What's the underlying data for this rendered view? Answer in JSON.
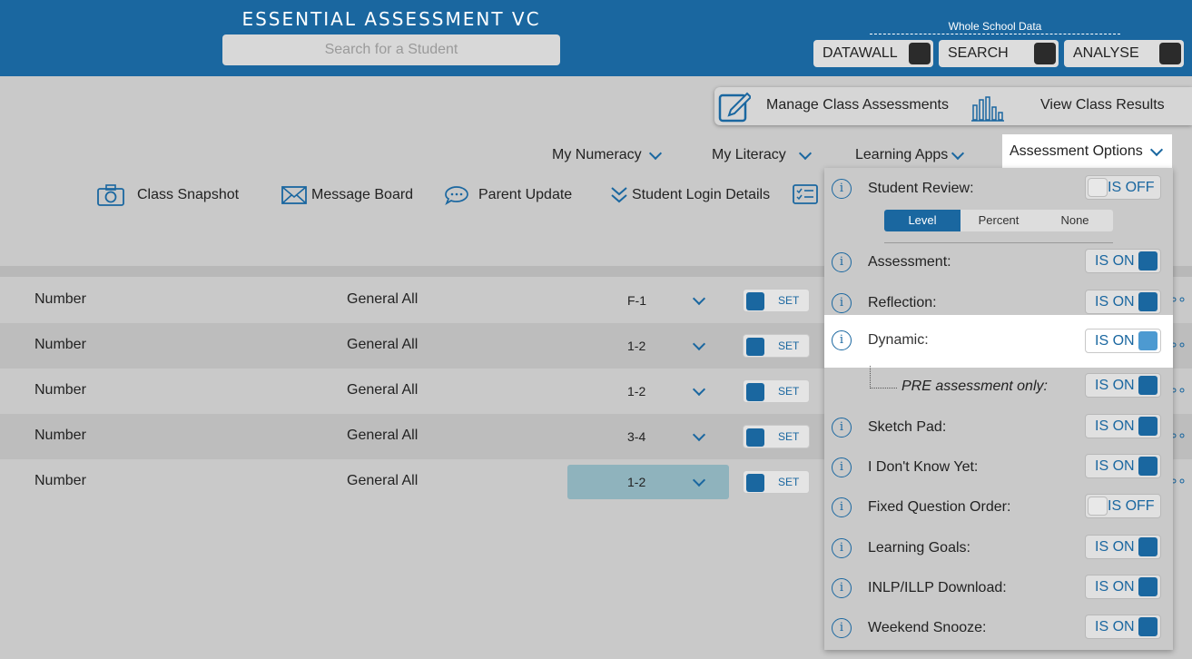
{
  "header": {
    "title": "ESSENTIAL ASSESSMENT VC",
    "search_placeholder": "Search for a Student",
    "whole_school_label": "Whole School Data",
    "buttons": [
      {
        "label": "DATAWALL"
      },
      {
        "label": "SEARCH"
      },
      {
        "label": "ANALYSE"
      }
    ]
  },
  "manage": {
    "manage_label": "Manage Class Assessments",
    "results_label": "View Class Results"
  },
  "nav": {
    "items": [
      {
        "label": "My Numeracy"
      },
      {
        "label": "My Literacy"
      },
      {
        "label": "Learning Apps"
      },
      {
        "label": "Assessment Options"
      }
    ]
  },
  "actions": {
    "items": [
      {
        "label": "Class Snapshot",
        "icon": "camera-icon"
      },
      {
        "label": "Message Board",
        "icon": "envelope-icon"
      },
      {
        "label": "Parent Update",
        "icon": "speech-bubble-icon"
      },
      {
        "label": "Student Login Details",
        "icon": "double-chevron-icon"
      }
    ]
  },
  "table": {
    "rows": [
      {
        "strand": "Number",
        "type": "General All",
        "year": "F-1",
        "set": "SET"
      },
      {
        "strand": "Number",
        "type": "General All",
        "year": "1-2",
        "set": "SET"
      },
      {
        "strand": "Number",
        "type": "General All",
        "year": "1-2",
        "set": "SET"
      },
      {
        "strand": "Number",
        "type": "General All",
        "year": "3-4",
        "set": "SET"
      },
      {
        "strand": "Number",
        "type": "General All",
        "year": "1-2",
        "set": "SET"
      }
    ]
  },
  "options": {
    "student_review": {
      "label": "Student Review:",
      "state": "IS OFF"
    },
    "segments": [
      "Level",
      "Percent",
      "None"
    ],
    "selected_segment": "Level",
    "items": [
      {
        "label": "Assessment:",
        "state": "IS ON"
      },
      {
        "label": "Reflection:",
        "state": "IS ON"
      },
      {
        "label": "Dynamic:",
        "state": "IS ON"
      },
      {
        "label": "PRE assessment only:",
        "state": "IS ON"
      },
      {
        "label": "Sketch Pad:",
        "state": "IS ON"
      },
      {
        "label": "I Don't Know Yet:",
        "state": "IS ON"
      },
      {
        "label": "Fixed Question Order:",
        "state": "IS OFF"
      },
      {
        "label": "Learning Goals:",
        "state": "IS ON"
      },
      {
        "label": "INLP/ILLP Download:",
        "state": "IS ON"
      },
      {
        "label": "Weekend Snooze:",
        "state": "IS ON"
      }
    ]
  },
  "colors": {
    "brand": "#1a67a0",
    "background": "#c9c9c9",
    "highlight": "#8fb3bd"
  }
}
